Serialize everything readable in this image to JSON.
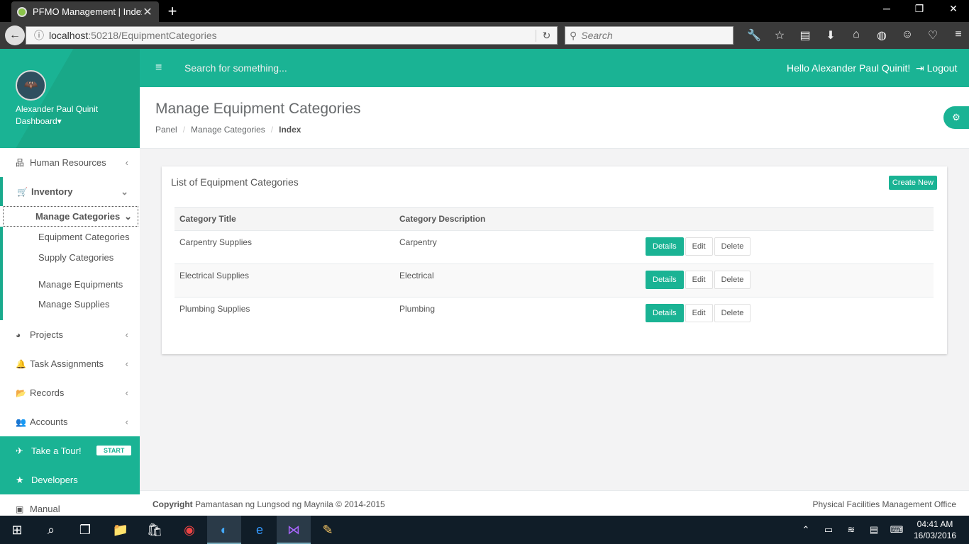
{
  "browser": {
    "tab_title": "PFMO Management | Index",
    "url_host": "localhost",
    "url_path": ":50218/EquipmentCategories",
    "search_placeholder": "Search"
  },
  "sidebar": {
    "user_name": "Alexander Paul Quinit",
    "dashboard_label": "Dashboard",
    "items": [
      {
        "label": "Human Resources",
        "icon": "sitemap-icon"
      },
      {
        "label": "Inventory",
        "icon": "cart-icon"
      },
      {
        "label": "Projects",
        "icon": "pie-chart-icon"
      },
      {
        "label": "Task Assignments",
        "icon": "bell-icon"
      },
      {
        "label": "Records",
        "icon": "folder-icon"
      },
      {
        "label": "Accounts",
        "icon": "users-icon"
      }
    ],
    "inventory_sub": {
      "manage_categories": "Manage Categories",
      "equipment_categories": "Equipment Categories",
      "supply_categories": "Supply Categories",
      "manage_equipments": "Manage Equipments",
      "manage_supplies": "Manage Supplies"
    },
    "tour_label": "Take a Tour!",
    "tour_badge": "START",
    "developers_label": "Developers",
    "manual_label": "Manual"
  },
  "topbar": {
    "search_placeholder": "Search for something...",
    "greeting": "Hello Alexander Paul Quinit!",
    "logout": "Logout"
  },
  "page": {
    "title": "Manage Equipment Categories",
    "breadcrumb": [
      "Panel",
      "Manage Categories",
      "Index"
    ]
  },
  "panel": {
    "title": "List of Equipment Categories",
    "create_label": "Create New",
    "columns": [
      "Category Title",
      "Category Description"
    ],
    "rows": [
      {
        "title": "Carpentry Supplies",
        "description": "Carpentry"
      },
      {
        "title": "Electrical Supplies",
        "description": "Electrical"
      },
      {
        "title": "Plumbing Supplies",
        "description": "Plumbing"
      }
    ],
    "actions": {
      "details": "Details",
      "edit": "Edit",
      "delete": "Delete"
    }
  },
  "footer": {
    "copyright_bold": "Copyright",
    "copyright_text": "Pamantasan ng Lungsod ng Maynila © 2014-2015",
    "office": "Physical Facilities Management Office"
  },
  "taskbar": {
    "time": "04:41 AM",
    "date": "16/03/2016"
  },
  "colors": {
    "accent": "#1ab394"
  }
}
